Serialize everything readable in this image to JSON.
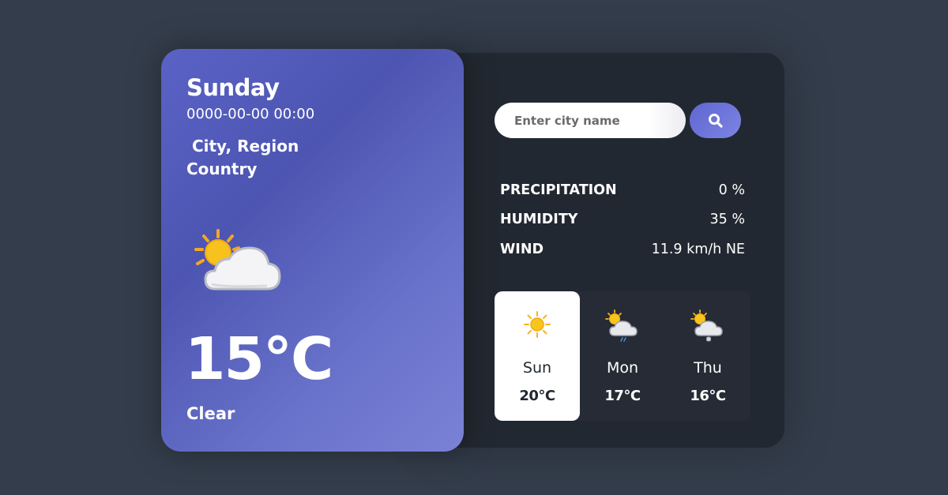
{
  "current": {
    "day": "Sunday",
    "datetime": "0000-00-00 00:00",
    "location": " City, Region\nCountry",
    "temperature": "15°C",
    "condition": "Clear",
    "icon": "partly-cloudy-icon"
  },
  "search": {
    "placeholder": "Enter city name",
    "button_icon": "search-icon"
  },
  "stats": [
    {
      "label": "PRECIPITATION",
      "value": "0 %"
    },
    {
      "label": "HUMIDITY",
      "value": "35 %"
    },
    {
      "label": "WIND",
      "value": "11.9 km/h NE"
    }
  ],
  "forecast": [
    {
      "day": "Sun",
      "temp": "20°C",
      "icon": "sun-icon",
      "active": true
    },
    {
      "day": "Mon",
      "temp": "17°C",
      "icon": "rain-cloud-icon",
      "active": false
    },
    {
      "day": "Thu",
      "temp": "16°C",
      "icon": "snow-cloud-icon",
      "active": false
    }
  ],
  "colors": {
    "background": "#343d4b",
    "panel": "#222831",
    "accent": "#5f66d1"
  }
}
